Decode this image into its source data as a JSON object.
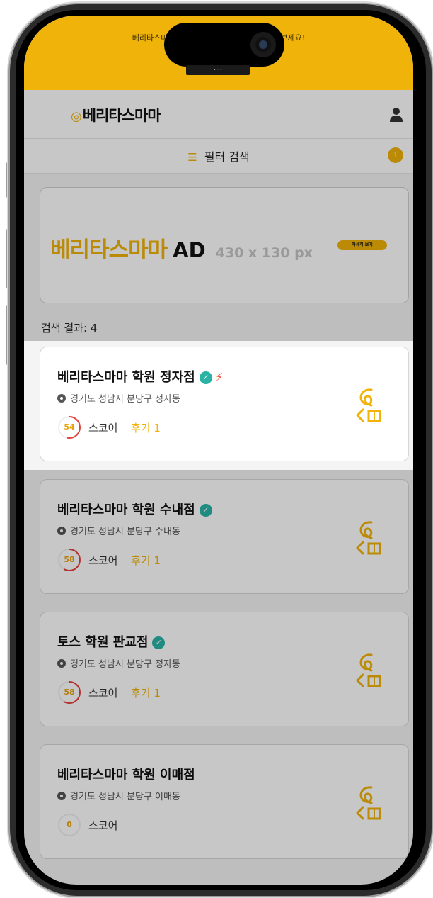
{
  "promo": {
    "text": "베리타스마마에서 우리 동네 학원 정보를 남겨보세요!",
    "color": "#f0b30a"
  },
  "header": {
    "logo": "베리타스마마"
  },
  "filter": {
    "label": "필터 검색",
    "badge": "1"
  },
  "ad": {
    "brand": "베리타스마마",
    "ad": "AD",
    "size": "430 x 130 px",
    "button": "자세히 보기"
  },
  "results": {
    "label": "검색 결과: 4"
  },
  "cards": [
    {
      "name": "베리타스마마 학원 정자점",
      "location": "경기도 성남시 분당구 정자동",
      "score": "54",
      "score_value": 54,
      "score_label": "스코어",
      "review": "후기 1",
      "verified": true,
      "hot": true,
      "highlighted": true
    },
    {
      "name": "베리타스마마 학원 수내점",
      "location": "경기도 성남시 분당구 수내동",
      "score": "58",
      "score_value": 58,
      "score_label": "스코어",
      "review": "후기 1",
      "verified": true,
      "hot": false,
      "highlighted": false
    },
    {
      "name": "토스 학원 판교점",
      "location": "경기도 성남시 분당구 정자동",
      "score": "58",
      "score_value": 58,
      "score_label": "스코어",
      "review": "후기 1",
      "verified": true,
      "hot": false,
      "highlighted": false
    },
    {
      "name": "베리타스마마 학원 이매점",
      "location": "경기도 성남시 분당구 이매동",
      "score": "0",
      "score_value": 0,
      "score_label": "스코어",
      "review": "",
      "verified": false,
      "hot": false,
      "highlighted": false
    }
  ]
}
